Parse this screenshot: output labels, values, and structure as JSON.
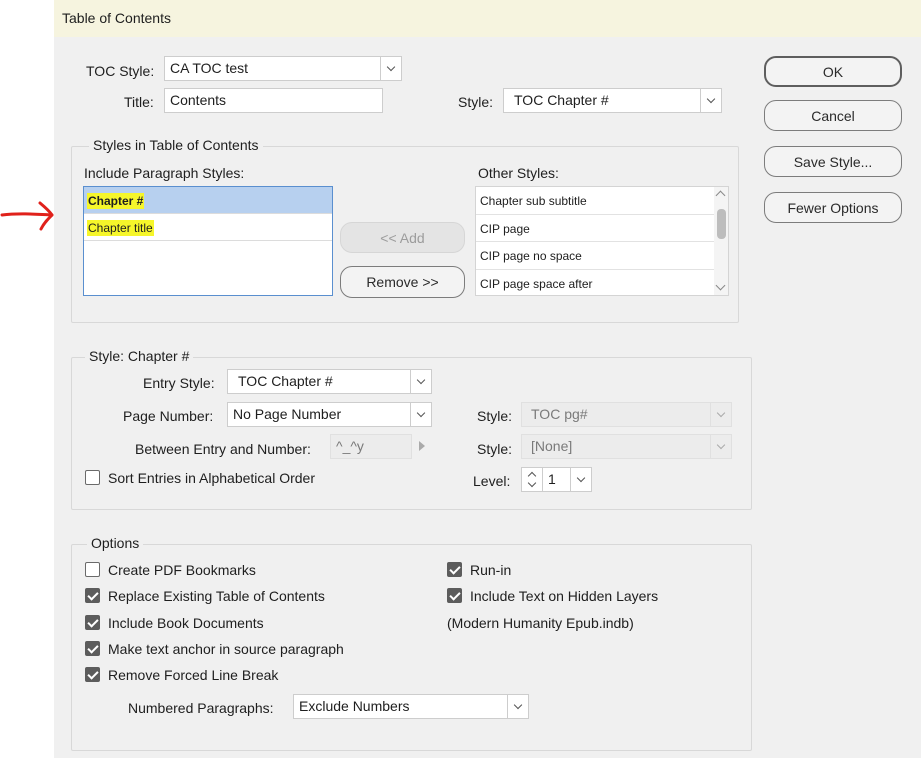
{
  "window": {
    "title": "Table of Contents"
  },
  "header": {
    "toc_style_label": "TOC Style:",
    "toc_style_value": "CA TOC test",
    "title_label": "Title:",
    "title_value": "Contents",
    "style_label": "Style:",
    "style_value": "TOC Chapter #"
  },
  "buttons": {
    "ok": "OK",
    "cancel": "Cancel",
    "save_style": "Save Style...",
    "fewer_options": "Fewer Options",
    "add": "<< Add",
    "remove": "Remove >>"
  },
  "styles_group": {
    "title": "Styles in Table of Contents",
    "include_label": "Include Paragraph Styles:",
    "include_items": [
      "Chapter #",
      "Chapter title"
    ],
    "other_label": "Other Styles:",
    "other_items": [
      "Chapter sub subtitle",
      "CIP page",
      "CIP page no space",
      "CIP page space after"
    ]
  },
  "style_group": {
    "title": "Style: Chapter #",
    "entry_style_label": "Entry Style:",
    "entry_style_value": "TOC Chapter #",
    "page_number_label": "Page Number:",
    "page_number_value": "No Page Number",
    "between_label": "Between Entry and Number:",
    "between_value": "^_^y",
    "style1_label": "Style:",
    "style1_value": "TOC pg#",
    "style2_label": "Style:",
    "style2_value": "[None]",
    "sort_label": "Sort Entries in Alphabetical Order",
    "sort_checked": false,
    "level_label": "Level:",
    "level_value": "1"
  },
  "options_group": {
    "title": "Options",
    "create_pdf_bookmarks": {
      "label": "Create PDF Bookmarks",
      "checked": false
    },
    "replace_existing": {
      "label": "Replace Existing Table of Contents",
      "checked": true
    },
    "include_book_docs": {
      "label": "Include Book Documents",
      "checked": true
    },
    "make_text_anchor": {
      "label": "Make text anchor in source paragraph",
      "checked": true
    },
    "remove_forced_line_break": {
      "label": "Remove Forced Line Break",
      "checked": true
    },
    "run_in": {
      "label": "Run-in",
      "checked": true
    },
    "include_hidden_layers": {
      "label": "Include Text on Hidden Layers",
      "checked": true
    },
    "book_file": "(Modern Humanity Epub.indb)",
    "numbered_paragraphs_label": "Numbered Paragraphs:",
    "numbered_paragraphs_value": "Exclude Numbers"
  },
  "colors": {
    "annotation_arrow": "#e0211b",
    "highlight": "#f6f62a",
    "selection": "#b7d0ef"
  }
}
